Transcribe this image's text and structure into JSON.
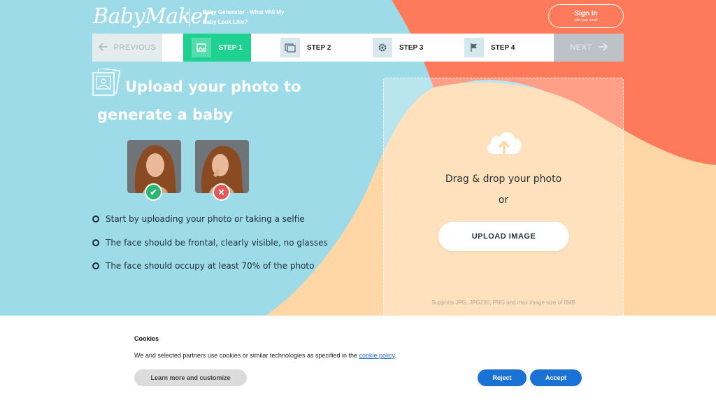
{
  "header": {
    "logo": "BabyMaker",
    "tagline": "Baby Generator - What Will My Baby Look Like?",
    "signin_label": "Sign In",
    "signin_sub": "with your email"
  },
  "steps": {
    "previous": "PREVIOUS",
    "next": "NEXT",
    "items": [
      {
        "label": "STEP 1",
        "icon": "image-icon",
        "active": true
      },
      {
        "label": "STEP 2",
        "icon": "images-icon",
        "active": false
      },
      {
        "label": "STEP 3",
        "icon": "gear-icon",
        "active": false
      },
      {
        "label": "STEP 4",
        "icon": "flag-icon",
        "active": false
      }
    ]
  },
  "main": {
    "heading_line1": "Upload your photo to",
    "heading_line2": "generate a baby",
    "rules": [
      "Start by uploading your photo or taking a selfie",
      "The face should be frontal, clearly visible, no glasses",
      "The face should occupy at least 70% of the photo"
    ],
    "good_badge": "✔",
    "bad_badge": "✕"
  },
  "upload": {
    "drag_text": "Drag & drop your photo",
    "or_text": "or",
    "button": "UPLOAD IMAGE",
    "supports": "Supports JPG, JPG200, PNG and max image size of 8MB"
  },
  "cookie": {
    "title": "Cookies",
    "message_prefix": "We and selected partners use cookies or similar technologies as specified in the ",
    "policy_link": "cookie policy",
    "message_suffix": ".",
    "learn_more": "Learn more and customize",
    "reject": "Reject",
    "accept": "Accept"
  },
  "colors": {
    "sky": "#9ddbe8",
    "coral": "#ff7a5a",
    "peach": "#ffd6a6",
    "step_active": "#1fd291",
    "button_blue": "#1a73d4"
  }
}
